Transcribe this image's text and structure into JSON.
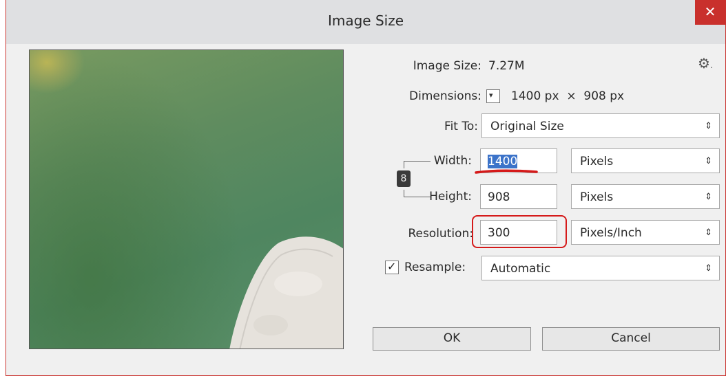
{
  "dialog": {
    "title": "Image Size",
    "close_label": "✕"
  },
  "info": {
    "image_size_label": "Image Size:",
    "image_size_value": "7.27M",
    "dimensions_label": "Dimensions:",
    "dimensions_value": "1400 px  ×  908 px",
    "settings_icon": "gear-icon"
  },
  "fit_to": {
    "label": "Fit To:",
    "value": "Original Size"
  },
  "width": {
    "label": "Width:",
    "value": "1400",
    "unit": "Pixels"
  },
  "height": {
    "label": "Height:",
    "value": "908",
    "unit": "Pixels"
  },
  "resolution": {
    "label": "Resolution:",
    "value": "300",
    "unit": "Pixels/Inch"
  },
  "resample": {
    "label": "Resample:",
    "checked": true,
    "value": "Automatic"
  },
  "buttons": {
    "ok": "OK",
    "cancel": "Cancel"
  },
  "colors": {
    "annotation_red": "#d51a1a",
    "selection_blue": "#3c73c9",
    "close_red": "#c9302c"
  }
}
